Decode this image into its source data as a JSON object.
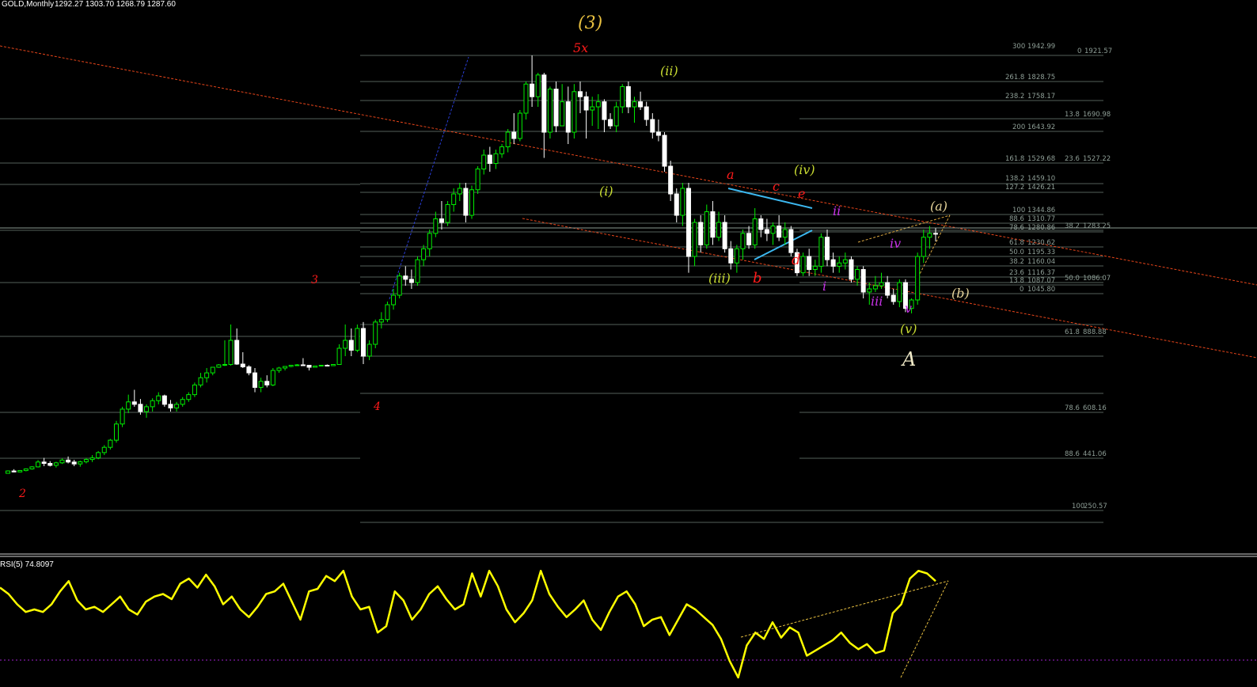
{
  "header": {
    "symbol": "GOLD,Monthly",
    "ohlc": "1292.27 1303.70 1268.79 1287.60"
  },
  "indicator": {
    "label": "RSI(5) 74.8097"
  },
  "colors": {
    "background": "#000000",
    "bull_candle": "#00ee00",
    "bear_candle": "#ffffff",
    "channel": "#e8451a",
    "fib_line": "#53605a",
    "fib_text": "#8e9e96",
    "rsi_line": "#ffff00",
    "triangle": "#3cb8f0",
    "red_label": "#ff1a1a",
    "green_label": "#c9dc32",
    "magenta_label": "#c832e8",
    "tan_label": "#e6d49a"
  },
  "chart_data": {
    "type": "candlestick",
    "title": "GOLD,Monthly",
    "fib_levels": {
      "left": [
        {
          "ratio": "300",
          "price": "1942.99"
        },
        {
          "ratio": "261.8",
          "price": "1828.75"
        },
        {
          "ratio": "238.2",
          "price": "1758.17"
        },
        {
          "ratio": "200",
          "price": "1643.92"
        },
        {
          "ratio": "161.8",
          "price": "1529.68"
        },
        {
          "ratio": "138.2",
          "price": "1459.10"
        },
        {
          "ratio": "127.2",
          "price": "1426.21"
        },
        {
          "ratio": "100",
          "price": "1344.86"
        },
        {
          "ratio": "88.6",
          "price": "1310.77"
        },
        {
          "ratio": "78.6",
          "price": "1280.86"
        },
        {
          "ratio": "61.8",
          "price": "1230.62"
        },
        {
          "ratio": "50.0",
          "price": "1195.33"
        },
        {
          "ratio": "38.2",
          "price": "1160.04"
        },
        {
          "ratio": "23.6",
          "price": "1116.37"
        },
        {
          "ratio": "13.8",
          "price": "1087.07"
        },
        {
          "ratio": "0",
          "price": "1045.80"
        }
      ],
      "right": [
        {
          "ratio": "0",
          "price": "1921.57"
        },
        {
          "ratio": "13.8",
          "price": "1690.98"
        },
        {
          "ratio": "23.6",
          "price": "1527.22"
        },
        {
          "ratio": "38.2",
          "price": "1283.25"
        },
        {
          "ratio": "50.0",
          "price": "1086.07"
        },
        {
          "ratio": "61.8",
          "price": "888.88"
        },
        {
          "ratio": "78.6",
          "price": "608.16"
        },
        {
          "ratio": "88.6",
          "price": "441.06"
        },
        {
          "ratio": "100",
          "price": "250.57"
        }
      ]
    },
    "wave_labels": [
      {
        "text": "(3)",
        "color": "gold"
      },
      {
        "text": "5x",
        "color": "red"
      },
      {
        "text": "3",
        "color": "red"
      },
      {
        "text": "4",
        "color": "red"
      },
      {
        "text": "2",
        "color": "red"
      },
      {
        "text": "(i)",
        "color": "green"
      },
      {
        "text": "(ii)",
        "color": "green"
      },
      {
        "text": "(iii)",
        "color": "green"
      },
      {
        "text": "(iv)",
        "color": "green"
      },
      {
        "text": "(v)",
        "color": "green"
      },
      {
        "text": "a",
        "color": "red"
      },
      {
        "text": "b",
        "color": "red"
      },
      {
        "text": "c",
        "color": "red"
      },
      {
        "text": "d",
        "color": "red"
      },
      {
        "text": "e",
        "color": "red"
      },
      {
        "text": "i",
        "color": "magenta"
      },
      {
        "text": "ii",
        "color": "magenta"
      },
      {
        "text": "iii",
        "color": "magenta"
      },
      {
        "text": "iv",
        "color": "magenta"
      },
      {
        "text": "v",
        "color": "magenta"
      },
      {
        "text": "(a)",
        "color": "tan"
      },
      {
        "text": "(b)",
        "color": "tan"
      },
      {
        "text": "A",
        "color": "white"
      }
    ],
    "candles_ohlc": [
      [
        388,
        410,
        378,
        405
      ],
      [
        405,
        418,
        395,
        398
      ],
      [
        398,
        412,
        395,
        408
      ],
      [
        408,
        424,
        402,
        420
      ],
      [
        420,
        440,
        415,
        435
      ],
      [
        435,
        462,
        430,
        455
      ],
      [
        455,
        470,
        440,
        450
      ],
      [
        450,
        458,
        438,
        443
      ],
      [
        443,
        456,
        430,
        452
      ],
      [
        452,
        468,
        448,
        462
      ],
      [
        462,
        475,
        450,
        455
      ],
      [
        455,
        463,
        440,
        448
      ],
      [
        448,
        460,
        436,
        456
      ],
      [
        456,
        470,
        450,
        464
      ],
      [
        464,
        480,
        455,
        470
      ],
      [
        470,
        493,
        465,
        488
      ],
      [
        488,
        512,
        480,
        505
      ],
      [
        505,
        532,
        498,
        528
      ],
      [
        528,
        590,
        520,
        580
      ],
      [
        580,
        640,
        570,
        630
      ],
      [
        630,
        690,
        615,
        660
      ],
      [
        660,
        710,
        640,
        650
      ],
      [
        650,
        672,
        610,
        620
      ],
      [
        620,
        650,
        600,
        640
      ],
      [
        640,
        675,
        620,
        665
      ],
      [
        665,
        700,
        650,
        685
      ],
      [
        685,
        690,
        640,
        650
      ],
      [
        650,
        668,
        620,
        635
      ],
      [
        635,
        660,
        620,
        650
      ],
      [
        650,
        680,
        640,
        670
      ],
      [
        670,
        700,
        660,
        690
      ],
      [
        690,
        740,
        680,
        730
      ],
      [
        730,
        780,
        720,
        760
      ],
      [
        760,
        800,
        740,
        780
      ],
      [
        780,
        830,
        770,
        820
      ],
      [
        820,
        900,
        805,
        880
      ],
      [
        880,
        960,
        850,
        890
      ],
      [
        890,
        1000,
        860,
        960
      ],
      [
        960,
        990,
        880,
        900
      ],
      [
        900,
        930,
        800,
        830
      ],
      [
        830,
        870,
        770,
        780
      ],
      [
        780,
        800,
        700,
        720
      ],
      [
        720,
        760,
        700,
        745
      ],
      [
        745,
        770,
        720,
        730
      ],
      [
        730,
        800,
        725,
        790
      ],
      [
        790,
        830,
        780,
        800
      ],
      [
        800,
        850,
        790,
        840
      ],
      [
        840,
        880,
        820,
        870
      ],
      [
        870,
        900,
        860,
        880
      ],
      [
        880,
        915,
        860,
        870
      ],
      [
        870,
        880,
        790,
        820
      ],
      [
        820,
        860,
        810,
        850
      ],
      [
        850,
        880,
        840,
        870
      ],
      [
        870,
        890,
        850,
        860
      ],
      [
        860,
        900,
        855,
        890
      ],
      [
        890,
        950,
        880,
        940
      ],
      [
        940,
        1000,
        920,
        960
      ],
      [
        960,
        990,
        920,
        935
      ],
      [
        935,
        1000,
        930,
        990
      ],
      [
        990,
        1010,
        900,
        920
      ],
      [
        920,
        960,
        910,
        950
      ],
      [
        950,
        1020,
        940,
        1010
      ],
      [
        1010,
        1050,
        990,
        1020
      ],
      [
        1020,
        1090,
        1010,
        1080
      ],
      [
        1080,
        1130,
        1060,
        1110
      ],
      [
        1110,
        1180,
        1100,
        1170
      ],
      [
        1170,
        1200,
        1140,
        1160
      ],
      [
        1160,
        1190,
        1130,
        1150
      ],
      [
        1150,
        1230,
        1140,
        1220
      ],
      [
        1220,
        1260,
        1200,
        1250
      ],
      [
        1250,
        1300,
        1230,
        1290
      ],
      [
        1290,
        1350,
        1280,
        1330
      ],
      [
        1330,
        1380,
        1300,
        1320
      ],
      [
        1320,
        1380,
        1310,
        1370
      ],
      [
        1370,
        1420,
        1350,
        1400
      ],
      [
        1400,
        1440,
        1380,
        1420
      ],
      [
        1420,
        1440,
        1320,
        1340
      ],
      [
        1340,
        1430,
        1330,
        1415
      ],
      [
        1415,
        1500,
        1400,
        1490
      ],
      [
        1490,
        1560,
        1470,
        1540
      ],
      [
        1540,
        1570,
        1480,
        1510
      ],
      [
        1510,
        1560,
        1490,
        1545
      ],
      [
        1545,
        1580,
        1530,
        1570
      ],
      [
        1570,
        1630,
        1550,
        1620
      ],
      [
        1620,
        1680,
        1580,
        1600
      ],
      [
        1600,
        1690,
        1590,
        1680
      ],
      [
        1680,
        1800,
        1660,
        1790
      ],
      [
        1790,
        1920,
        1700,
        1740
      ],
      [
        1740,
        1840,
        1700,
        1830
      ],
      [
        1830,
        1840,
        1530,
        1620
      ],
      [
        1620,
        1780,
        1600,
        1770
      ],
      [
        1770,
        1800,
        1620,
        1640
      ],
      [
        1640,
        1790,
        1640,
        1720
      ],
      [
        1720,
        1780,
        1580,
        1620
      ],
      [
        1620,
        1790,
        1600,
        1760
      ],
      [
        1760,
        1800,
        1680,
        1740
      ],
      [
        1740,
        1760,
        1600,
        1690
      ],
      [
        1690,
        1740,
        1640,
        1700
      ],
      [
        1700,
        1750,
        1630,
        1720
      ],
      [
        1720,
        1730,
        1620,
        1660
      ],
      [
        1660,
        1680,
        1630,
        1640
      ],
      [
        1640,
        1720,
        1620,
        1700
      ],
      [
        1700,
        1790,
        1680,
        1780
      ],
      [
        1780,
        1800,
        1680,
        1700
      ],
      [
        1700,
        1740,
        1650,
        1720
      ],
      [
        1720,
        1760,
        1690,
        1700
      ],
      [
        1700,
        1720,
        1640,
        1660
      ],
      [
        1660,
        1680,
        1600,
        1620
      ],
      [
        1620,
        1660,
        1590,
        1610
      ],
      [
        1610,
        1620,
        1480,
        1500
      ],
      [
        1500,
        1520,
        1380,
        1400
      ],
      [
        1400,
        1420,
        1320,
        1340
      ],
      [
        1340,
        1440,
        1310,
        1420
      ],
      [
        1420,
        1440,
        1180,
        1230
      ],
      [
        1230,
        1330,
        1200,
        1320
      ],
      [
        1320,
        1340,
        1240,
        1260
      ],
      [
        1260,
        1370,
        1250,
        1350
      ],
      [
        1350,
        1380,
        1260,
        1280
      ],
      [
        1280,
        1350,
        1270,
        1320
      ],
      [
        1320,
        1340,
        1240,
        1250
      ],
      [
        1250,
        1270,
        1190,
        1210
      ],
      [
        1210,
        1260,
        1180,
        1250
      ],
      [
        1250,
        1300,
        1220,
        1290
      ],
      [
        1290,
        1310,
        1250,
        1260
      ],
      [
        1260,
        1360,
        1250,
        1330
      ],
      [
        1330,
        1340,
        1280,
        1300
      ],
      [
        1300,
        1330,
        1270,
        1290
      ],
      [
        1290,
        1320,
        1260,
        1310
      ],
      [
        1310,
        1340,
        1270,
        1280
      ],
      [
        1280,
        1320,
        1260,
        1300
      ],
      [
        1300,
        1310,
        1230,
        1240
      ],
      [
        1240,
        1250,
        1170,
        1180
      ],
      [
        1180,
        1240,
        1170,
        1230
      ],
      [
        1230,
        1250,
        1170,
        1190
      ],
      [
        1190,
        1220,
        1170,
        1200
      ],
      [
        1200,
        1290,
        1180,
        1280
      ],
      [
        1280,
        1300,
        1200,
        1220
      ],
      [
        1220,
        1240,
        1180,
        1200
      ],
      [
        1200,
        1230,
        1180,
        1210
      ],
      [
        1210,
        1240,
        1190,
        1220
      ],
      [
        1220,
        1230,
        1150,
        1160
      ],
      [
        1160,
        1200,
        1140,
        1190
      ],
      [
        1190,
        1200,
        1100,
        1120
      ],
      [
        1120,
        1150,
        1080,
        1130
      ],
      [
        1130,
        1170,
        1120,
        1140
      ],
      [
        1140,
        1180,
        1130,
        1150
      ],
      [
        1150,
        1170,
        1100,
        1110
      ],
      [
        1110,
        1130,
        1080,
        1090
      ],
      [
        1090,
        1160,
        1070,
        1150
      ],
      [
        1150,
        1160,
        1050,
        1065
      ],
      [
        1065,
        1100,
        1045,
        1095
      ],
      [
        1095,
        1240,
        1080,
        1230
      ],
      [
        1230,
        1300,
        1210,
        1280
      ],
      [
        1280,
        1310,
        1250,
        1290
      ],
      [
        1290,
        1304,
        1269,
        1288
      ]
    ],
    "rsi": [
      65,
      60,
      52,
      46,
      48,
      46,
      52,
      62,
      70,
      55,
      48,
      50,
      46,
      52,
      58,
      48,
      44,
      54,
      58,
      60,
      56,
      68,
      72,
      65,
      75,
      66,
      52,
      58,
      48,
      42,
      50,
      60,
      62,
      68,
      54,
      40,
      62,
      64,
      74,
      70,
      78,
      58,
      48,
      50,
      30,
      35,
      62,
      55,
      40,
      48,
      60,
      66,
      56,
      48,
      52,
      76,
      58,
      78,
      66,
      48,
      38,
      45,
      55,
      78,
      60,
      50,
      42,
      48,
      55,
      40,
      32,
      46,
      58,
      62,
      52,
      35,
      40,
      42,
      28,
      40,
      52,
      48,
      42,
      36,
      25,
      8,
      -5,
      20,
      30,
      25,
      38,
      26,
      34,
      30,
      12,
      16,
      20,
      24,
      30,
      22,
      17,
      21,
      14,
      16,
      45,
      52,
      72,
      78,
      76,
      70
    ]
  }
}
